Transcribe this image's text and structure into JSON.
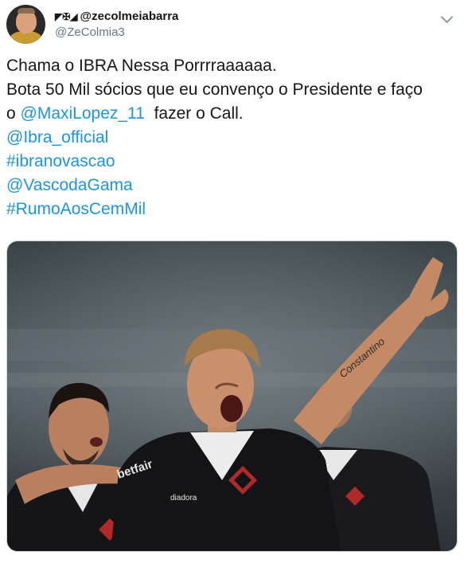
{
  "user": {
    "display_flags": "◤✠◢",
    "display_name": "@zecolmeiabarra",
    "handle": "@ZeColmia3"
  },
  "tweet": {
    "line1": "Chama o IBRA Nessa Porrrraaaaaa.",
    "line2": "Bota 50 Mil sócios que eu convenço o Presidente e faço",
    "line3_prefix": "o",
    "mention1": "@MaxiLopez_11",
    "line3_suffix": "fazer o Call.",
    "mention2": "@Ibra_official",
    "hashtag1": "#ibranovascao",
    "mention3": "@VascodaGama",
    "hashtag2": "#RumoAosCemMil"
  },
  "media": {
    "tattoo_text": "Constantino",
    "shirt_brand": "diadora",
    "sponsor": "betfair"
  },
  "colors": {
    "link": "#1b95e0",
    "text": "#14171a",
    "secondary": "#657786"
  },
  "icons": {
    "caret": "chevron-down-icon"
  }
}
